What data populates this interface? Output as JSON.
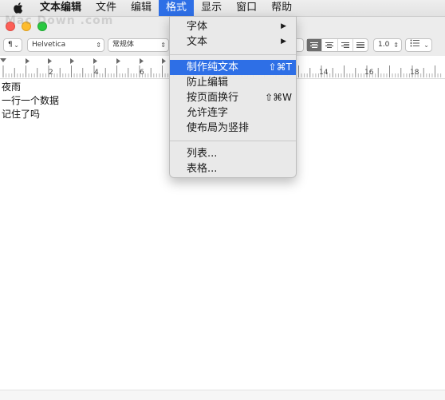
{
  "menubar": {
    "apple_icon": "apple-icon",
    "items": [
      "文本编辑",
      "文件",
      "编辑",
      "格式",
      "显示",
      "窗口",
      "帮助"
    ],
    "active_index": 3,
    "active_color": "#2e6fe6"
  },
  "window": {
    "traffic_lights": [
      "#fc5f57",
      "#fdbc2e",
      "#28c940"
    ]
  },
  "toolbar": {
    "paragraph_style": "¶",
    "font_family": "Helvetica",
    "font_style": "常规体",
    "line_spacing": "1.0",
    "list_icon": "list-icon",
    "alignment_selected": "left"
  },
  "ruler": {
    "numbers": [
      "2",
      "4",
      "6",
      "14",
      "16",
      "18"
    ]
  },
  "document": {
    "lines": [
      "夜雨",
      "一行一个数据",
      "记住了吗"
    ]
  },
  "format_menu": {
    "groups": [
      [
        {
          "label": "字体",
          "submenu": true
        },
        {
          "label": "文本",
          "submenu": true
        }
      ],
      [
        {
          "label": "制作纯文本",
          "shortcut": "⇧⌘T",
          "highlighted": true
        },
        {
          "label": "防止编辑"
        },
        {
          "label": "按页面换行",
          "shortcut": "⇧⌘W"
        },
        {
          "label": "允许连字"
        },
        {
          "label": "使布局为竖排"
        }
      ],
      [
        {
          "label": "列表..."
        },
        {
          "label": "表格..."
        }
      ]
    ]
  },
  "watermark": "Mac Down .com"
}
